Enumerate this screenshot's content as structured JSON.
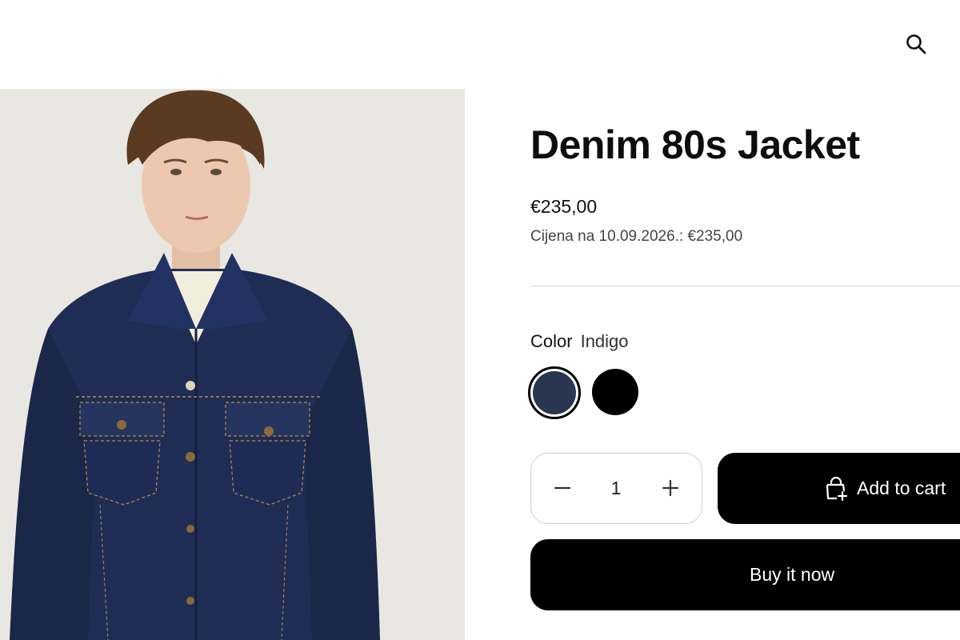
{
  "header": {
    "search_icon": "search-icon"
  },
  "product": {
    "title": "Denim 80s Jacket",
    "price": "€235,00",
    "unit_price": "Cijena na 10.09.2026.: €235,00"
  },
  "color": {
    "label": "Color",
    "selected": "Indigo",
    "swatches": [
      {
        "name": "Indigo",
        "hex": "#2a3550",
        "selected": true
      },
      {
        "name": "Black",
        "hex": "#000000",
        "selected": false
      }
    ]
  },
  "quantity": {
    "value": "1",
    "minus_icon": "minus-icon",
    "plus_icon": "plus-icon"
  },
  "actions": {
    "add_to_cart": "Add to cart",
    "buy_now": "Buy it now"
  },
  "colors": {
    "button_bg": "#000000",
    "button_text": "#ffffff",
    "photo_bg": "#e9e7e2"
  }
}
